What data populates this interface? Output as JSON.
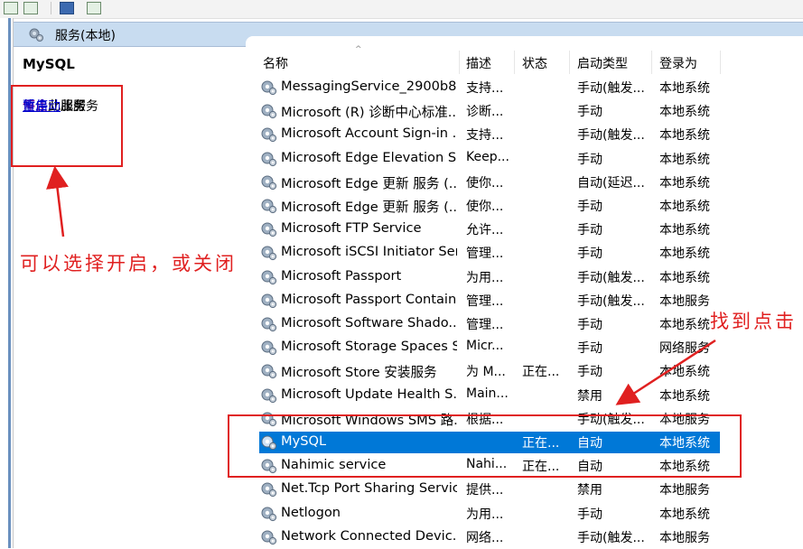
{
  "header": {
    "title": "服务(本地)"
  },
  "left_panel": {
    "service_name": "MySQL",
    "actions": [
      {
        "link": "停止",
        "suffix": "此服务"
      },
      {
        "link": "暂停",
        "suffix": "此服务"
      },
      {
        "link": "重启动",
        "suffix": "此服务"
      }
    ]
  },
  "annotations": {
    "left_note": "可以选择开启，或关闭",
    "right_note": "找到点击"
  },
  "table": {
    "columns": [
      "名称",
      "描述",
      "状态",
      "启动类型",
      "登录为"
    ],
    "rows": [
      {
        "name": "MessagingService_2900b8...",
        "desc": "支持...",
        "status": "",
        "startup": "手动(触发...",
        "logon": "本地系统"
      },
      {
        "name": "Microsoft (R) 诊断中心标准...",
        "desc": "诊断...",
        "status": "",
        "startup": "手动",
        "logon": "本地系统"
      },
      {
        "name": "Microsoft Account Sign-in ...",
        "desc": "支持...",
        "status": "",
        "startup": "手动(触发...",
        "logon": "本地系统"
      },
      {
        "name": "Microsoft Edge Elevation S...",
        "desc": "Keep...",
        "status": "",
        "startup": "手动",
        "logon": "本地系统"
      },
      {
        "name": "Microsoft Edge 更新 服务 (...",
        "desc": "使你...",
        "status": "",
        "startup": "自动(延迟...",
        "logon": "本地系统"
      },
      {
        "name": "Microsoft Edge 更新 服务 (...",
        "desc": "使你...",
        "status": "",
        "startup": "手动",
        "logon": "本地系统"
      },
      {
        "name": "Microsoft FTP Service",
        "desc": "允许...",
        "status": "",
        "startup": "手动",
        "logon": "本地系统"
      },
      {
        "name": "Microsoft iSCSI Initiator Ser...",
        "desc": "管理...",
        "status": "",
        "startup": "手动",
        "logon": "本地系统"
      },
      {
        "name": "Microsoft Passport",
        "desc": "为用...",
        "status": "",
        "startup": "手动(触发...",
        "logon": "本地系统"
      },
      {
        "name": "Microsoft Passport Container",
        "desc": "管理...",
        "status": "",
        "startup": "手动(触发...",
        "logon": "本地服务"
      },
      {
        "name": "Microsoft Software Shado...",
        "desc": "管理...",
        "status": "",
        "startup": "手动",
        "logon": "本地系统"
      },
      {
        "name": "Microsoft Storage Spaces S...",
        "desc": "Micr...",
        "status": "",
        "startup": "手动",
        "logon": "网络服务"
      },
      {
        "name": "Microsoft Store 安装服务",
        "desc": "为 M...",
        "status": "正在...",
        "startup": "手动",
        "logon": "本地系统"
      },
      {
        "name": "Microsoft Update Health S...",
        "desc": "Main...",
        "status": "",
        "startup": "禁用",
        "logon": "本地系统"
      },
      {
        "name": "Microsoft Windows SMS 路...",
        "desc": "根据...",
        "status": "",
        "startup": "手动(触发...",
        "logon": "本地服务"
      },
      {
        "name": "MySQL",
        "desc": "",
        "status": "正在...",
        "startup": "自动",
        "logon": "本地系统",
        "selected": true
      },
      {
        "name": "Nahimic service",
        "desc": "Nahi...",
        "status": "正在...",
        "startup": "自动",
        "logon": "本地系统"
      },
      {
        "name": "Net.Tcp Port Sharing Service",
        "desc": "提供...",
        "status": "",
        "startup": "禁用",
        "logon": "本地服务"
      },
      {
        "name": "Netlogon",
        "desc": "为用...",
        "status": "",
        "startup": "手动",
        "logon": "本地系统"
      },
      {
        "name": "Network Connected Devic...",
        "desc": "网络...",
        "status": "",
        "startup": "手动(触发...",
        "logon": "本地服务"
      }
    ]
  }
}
